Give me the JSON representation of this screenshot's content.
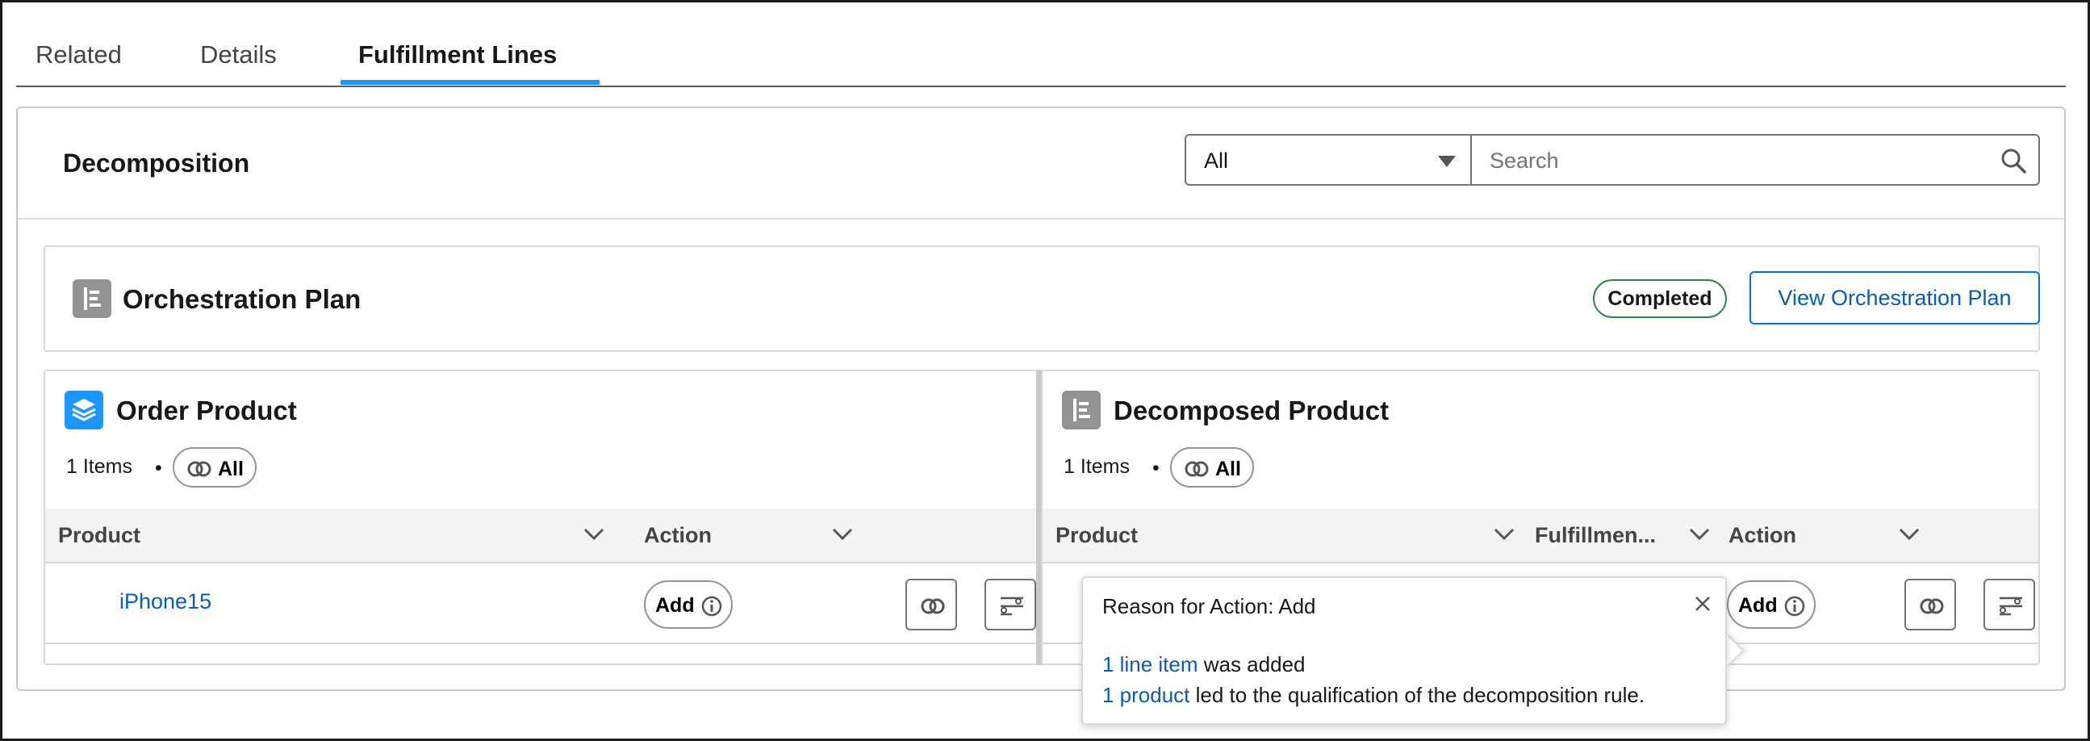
{
  "tabs": [
    {
      "label": "Related"
    },
    {
      "label": "Details"
    },
    {
      "label": "Fulfillment Lines",
      "active": true
    }
  ],
  "decomposition": {
    "title": "Decomposition",
    "filter_value": "All",
    "search_placeholder": "Search"
  },
  "plan": {
    "title": "Orchestration Plan",
    "status": "Completed",
    "view_button": "View Orchestration Plan"
  },
  "order_panel": {
    "title": "Order Product",
    "count": "1 Items",
    "dot": "•",
    "all_label": "All",
    "columns": [
      "Product",
      "Action"
    ],
    "rows": [
      {
        "product": "iPhone15",
        "action": "Add"
      }
    ]
  },
  "decomposed_panel": {
    "title": "Decomposed Product",
    "count": "1 Items",
    "dot": "•",
    "all_label": "All",
    "columns": [
      "Product",
      "Fulfillmen...",
      "Action"
    ],
    "rows": [
      {
        "product": "",
        "action": "Add"
      }
    ]
  },
  "popover": {
    "title": "Reason for Action: Add",
    "line1_link": "1 line item",
    "line1_text": " was added",
    "line2_link": "1 product",
    "line2_text": " led to the qualification of the decomposition rule."
  },
  "colors": {
    "accent": "#1b96ff",
    "link": "#0b5cab",
    "success": "#2e844a",
    "order_icon": "#1b96ff",
    "plan_icon": "#939393"
  },
  "icons": [
    "search-icon",
    "dropdown-caret-icon",
    "orchestration-plan-icon",
    "order-product-icon",
    "decomposed-product-icon",
    "link-icon",
    "info-icon",
    "chevron-down-icon",
    "filter-lines-icon",
    "close-icon"
  ]
}
